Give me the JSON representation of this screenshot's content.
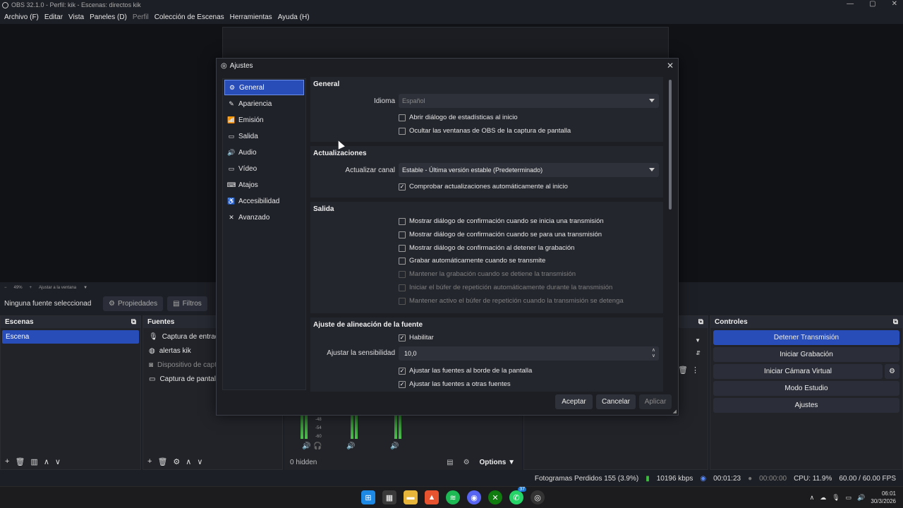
{
  "window": {
    "title": "OBS 32.1.0 - Perfil: kik - Escenas: directos kik",
    "controls": [
      "—",
      "▢",
      "✕"
    ]
  },
  "menu": [
    "Archivo (F)",
    "Editar",
    "Vista",
    "Paneles (D)",
    "Perfil",
    "Colección de Escenas",
    "Herramientas",
    "Ayuda (H)"
  ],
  "preview": {
    "zoom": "49%",
    "fit_label": "Ajustar a la ventana"
  },
  "properties_bar": {
    "no_source": "Ninguna fuente seleccionad",
    "properties": "Propiedades",
    "filters": "Filtros"
  },
  "scenes": {
    "title": "Escenas",
    "items": [
      "Escena"
    ]
  },
  "sources": {
    "title": "Fuentes",
    "items": [
      {
        "label": "Captura de entrada a",
        "icon": "mic-icon"
      },
      {
        "label": "alertas kik",
        "icon": "globe-icon"
      },
      {
        "label": "Dispositivo de captu",
        "icon": "camera-icon"
      },
      {
        "label": "Captura de pantalla",
        "icon": "monitor-icon"
      }
    ]
  },
  "mixer": {
    "hidden": "0 hidden",
    "options": "Options",
    "ticks": [
      "-48",
      "-54",
      "-60"
    ]
  },
  "controls": {
    "title": "Controles",
    "stop_stream": "Detener Transmisión",
    "start_recording": "Iniciar Grabación",
    "start_virtual_cam": "Iniciar Cámara Virtual",
    "studio_mode": "Modo Estudio",
    "settings": "Ajustes"
  },
  "status": {
    "dropped_frames": "Fotogramas Perdidos 155 (3.9%)",
    "bitrate": "10196 kbps",
    "stream_time": "00:01:23",
    "rec_time": "00:00:00",
    "cpu": "CPU: 11.9%",
    "fps": "60.00 / 60.00 FPS"
  },
  "taskbar": {
    "time": "06:01",
    "date": "30/3/2026",
    "badge": "37"
  },
  "dialog": {
    "title": "Ajustes",
    "nav": [
      {
        "label": "General",
        "icon": "gear-icon",
        "glyph": "⚙"
      },
      {
        "label": "Apariencia",
        "icon": "paint-icon",
        "glyph": "✎"
      },
      {
        "label": "Emisión",
        "icon": "antenna-icon",
        "glyph": "📶"
      },
      {
        "label": "Salida",
        "icon": "output-icon",
        "glyph": "▭"
      },
      {
        "label": "Audio",
        "icon": "speaker-icon",
        "glyph": "🔊"
      },
      {
        "label": "Vídeo",
        "icon": "monitor-icon",
        "glyph": "▭"
      },
      {
        "label": "Atajos",
        "icon": "keyboard-icon",
        "glyph": "⌨"
      },
      {
        "label": "Accesibilidad",
        "icon": "accessibility-icon",
        "glyph": "♿"
      },
      {
        "label": "Avanzado",
        "icon": "tools-icon",
        "glyph": "✕"
      }
    ],
    "general": {
      "title": "General",
      "language_label": "Idioma",
      "language_value": "Español",
      "open_stats": "Abrir diálogo de estadísticas al inicio",
      "hide_windows": "Ocultar las ventanas de OBS de la captura de pantalla"
    },
    "updates": {
      "title": "Actualizaciones",
      "channel_label": "Actualizar canal",
      "channel_value": "Estable - Última versión estable (Predeterminado)",
      "auto_check": "Comprobar actualizaciones automáticamente al inicio"
    },
    "output": {
      "title": "Salida",
      "items": [
        {
          "label": "Mostrar diálogo de confirmación cuando se inicia una transmisión",
          "checked": false,
          "enabled": true
        },
        {
          "label": "Mostrar diálogo de confirmación cuando se para una transmisión",
          "checked": false,
          "enabled": true
        },
        {
          "label": "Mostrar diálogo de confirmación al detener la grabación",
          "checked": false,
          "enabled": true
        },
        {
          "label": "Grabar automáticamente cuando se transmite",
          "checked": false,
          "enabled": true
        },
        {
          "label": "Mantener la grabación cuando se detiene la transmisión",
          "checked": false,
          "enabled": false
        },
        {
          "label": "Iniciar el búfer de repetición automáticamente durante la transmisión",
          "checked": false,
          "enabled": false
        },
        {
          "label": "Mantener activo el búfer de repetición cuando la transmisión se detenga",
          "checked": false,
          "enabled": false
        }
      ]
    },
    "snapping": {
      "title": "Ajuste de alineación de la fuente",
      "enable": "Habilitar",
      "sensitivity_label": "Ajustar la sensibilidad",
      "sensitivity_value": "10,0",
      "screen_edges": "Ajustar las fuentes al borde de la pantalla",
      "other_sources": "Ajustar las fuentes a otras fuentes"
    },
    "buttons": {
      "accept": "Aceptar",
      "cancel": "Cancelar",
      "apply": "Aplicar"
    }
  }
}
